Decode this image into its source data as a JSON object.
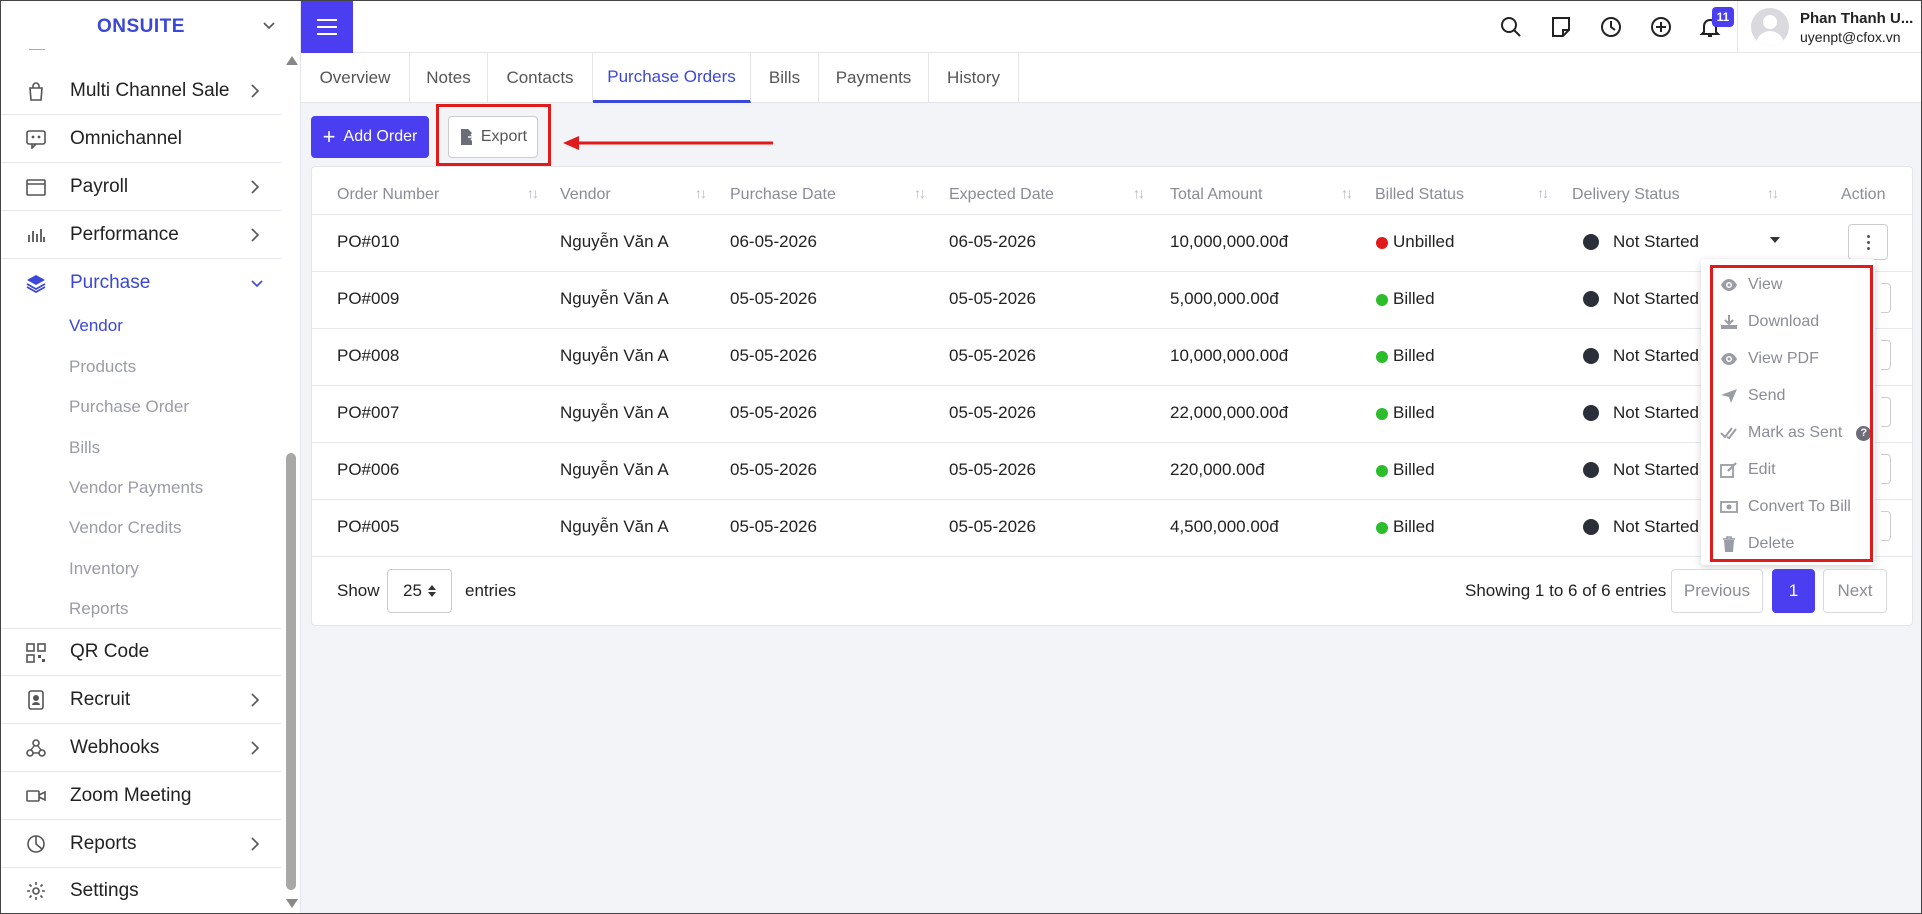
{
  "brand": {
    "name": "ONSUITE"
  },
  "sidebar": {
    "items": [
      {
        "label": "Multi Channel Sale",
        "icon": "bag-icon",
        "has_arrow": true
      },
      {
        "label": "Omnichannel",
        "icon": "chat-icon",
        "has_arrow": false
      },
      {
        "label": "Payroll",
        "icon": "wallet-icon",
        "has_arrow": true
      },
      {
        "label": "Performance",
        "icon": "bar-chart-icon",
        "has_arrow": true
      },
      {
        "label": "Purchase",
        "icon": "layers-icon",
        "has_arrow": true,
        "expanded": true
      },
      {
        "label": "QR Code",
        "icon": "qr-icon",
        "has_arrow": false
      },
      {
        "label": "Recruit",
        "icon": "badge-icon",
        "has_arrow": true
      },
      {
        "label": "Webhooks",
        "icon": "webhook-icon",
        "has_arrow": true
      },
      {
        "label": "Zoom Meeting",
        "icon": "video-icon",
        "has_arrow": false
      },
      {
        "label": "Reports",
        "icon": "pie-icon",
        "has_arrow": true
      },
      {
        "label": "Settings",
        "icon": "gear-icon",
        "has_arrow": false
      }
    ],
    "purchase_sub": [
      "Vendor",
      "Products",
      "Purchase Order",
      "Bills",
      "Vendor Payments",
      "Vendor Credits",
      "Inventory",
      "Reports"
    ],
    "active_sub": "Vendor"
  },
  "topbar": {
    "notification_count": "11",
    "user_name": "Phan Thanh U...",
    "user_email": "uyenpt@cfox.vn"
  },
  "tabs": [
    "Overview",
    "Notes",
    "Contacts",
    "Purchase Orders",
    "Bills",
    "Payments",
    "History"
  ],
  "active_tab": "Purchase Orders",
  "toolbar": {
    "add_label": "Add Order",
    "export_label": "Export"
  },
  "table": {
    "headers": [
      "Order Number",
      "Vendor",
      "Purchase Date",
      "Expected Date",
      "Total Amount",
      "Billed Status",
      "Delivery Status",
      "Action"
    ],
    "rows": [
      {
        "order": "PO#010",
        "vendor": "Nguyễn Văn A",
        "purchase_date": "06-05-2026",
        "expected_date": "06-05-2026",
        "total": "10,000,000.00đ",
        "billed": "Unbilled",
        "delivery": "Not Started"
      },
      {
        "order": "PO#009",
        "vendor": "Nguyễn Văn A",
        "purchase_date": "05-05-2026",
        "expected_date": "05-05-2026",
        "total": "5,000,000.00đ",
        "billed": "Billed",
        "delivery": "Not Started"
      },
      {
        "order": "PO#008",
        "vendor": "Nguyễn Văn A",
        "purchase_date": "05-05-2026",
        "expected_date": "05-05-2026",
        "total": "10,000,000.00đ",
        "billed": "Billed",
        "delivery": "Not Started"
      },
      {
        "order": "PO#007",
        "vendor": "Nguyễn Văn A",
        "purchase_date": "05-05-2026",
        "expected_date": "05-05-2026",
        "total": "22,000,000.00đ",
        "billed": "Billed",
        "delivery": "Not Started"
      },
      {
        "order": "PO#006",
        "vendor": "Nguyễn Văn A",
        "purchase_date": "05-05-2026",
        "expected_date": "05-05-2026",
        "total": "220,000.00đ",
        "billed": "Billed",
        "delivery": "Not Started"
      },
      {
        "order": "PO#005",
        "vendor": "Nguyễn Văn A",
        "purchase_date": "05-05-2026",
        "expected_date": "05-05-2026",
        "total": "4,500,000.00đ",
        "billed": "Billed",
        "delivery": "Not Started"
      }
    ]
  },
  "action_menu": [
    "View",
    "Download",
    "View PDF",
    "Send",
    "Mark as Sent",
    "Edit",
    "Convert To Bill",
    "Delete"
  ],
  "footer": {
    "show_label": "Show",
    "page_length": "25",
    "entries_label": "entries",
    "info": "Showing 1 to 6 of 6 entries",
    "prev_label": "Previous",
    "page": "1",
    "next_label": "Next"
  },
  "colors": {
    "accent": "#4b3ef0",
    "billed": "#2bbd2b",
    "unbilled": "#e01b1b",
    "annotation": "#e01b1b"
  }
}
